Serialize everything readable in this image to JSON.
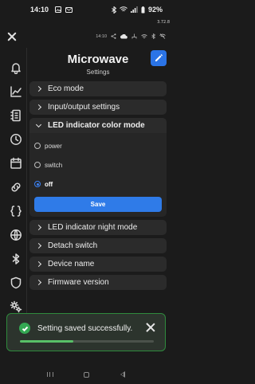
{
  "status_bar": {
    "time": "14:10",
    "battery": "92%"
  },
  "app_version": "3.72.8",
  "header": {
    "mini_time": "14:10"
  },
  "sidebar": {
    "items": [
      {
        "icon": "bell-icon"
      },
      {
        "icon": "trend-chart-icon"
      },
      {
        "icon": "device-list-icon"
      },
      {
        "icon": "clock-icon"
      },
      {
        "icon": "calendar-icon"
      },
      {
        "icon": "link-icon"
      },
      {
        "icon": "braces-icon"
      },
      {
        "icon": "globe-icon"
      },
      {
        "icon": "bluetooth-icon"
      },
      {
        "icon": "shield-icon"
      },
      {
        "icon": "gears-icon"
      }
    ]
  },
  "page": {
    "title": "Microwave",
    "subtitle": "Settings"
  },
  "sections": {
    "eco": "Eco mode",
    "io": "Input/output settings",
    "led_color": "LED indicator color mode",
    "led_night": "LED indicator night mode",
    "detach": "Detach switch",
    "device_name": "Device name",
    "firmware": "Firmware version"
  },
  "led_options": [
    {
      "label": "power",
      "selected": false
    },
    {
      "label": "switch",
      "selected": false
    },
    {
      "label": "off",
      "selected": true
    }
  ],
  "save_label": "Save",
  "toast": {
    "message": "Setting saved successfully.",
    "progress": 0.4
  },
  "colors": {
    "accent": "#2f7be8",
    "success": "#34a853",
    "background": "#1b1b1b"
  }
}
